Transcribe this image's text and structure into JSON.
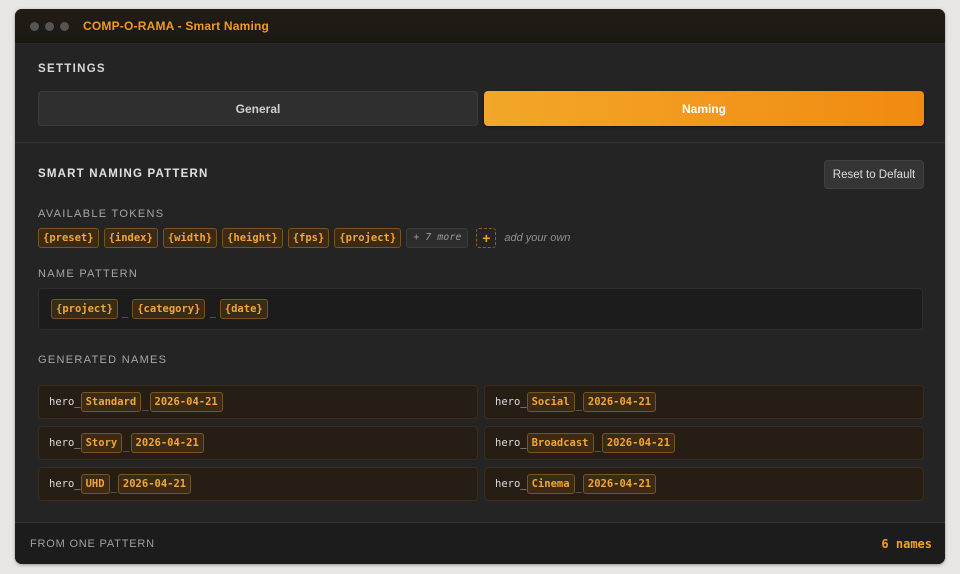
{
  "window": {
    "title": "COMP-O-RAMA - Smart Naming"
  },
  "settings": {
    "label": "SETTINGS",
    "tabs": [
      {
        "label": "General",
        "active": false
      },
      {
        "label": "Naming",
        "active": true
      }
    ]
  },
  "smart_naming": {
    "title": "SMART NAMING PATTERN",
    "reset_label": "Reset to Default",
    "available_tokens_label": "AVAILABLE TOKENS",
    "tokens": [
      "{preset}",
      "{index}",
      "{width}",
      "{height}",
      "{fps}",
      "{project}"
    ],
    "more_label": "+ 7 more",
    "add_symbol": "+",
    "add_label": "add your own",
    "name_pattern_label": "NAME PATTERN",
    "pattern": {
      "tokens": [
        "{project}",
        "{category}",
        "{date}"
      ],
      "separator": "_"
    },
    "generated_label": "GENERATED NAMES",
    "generated": [
      {
        "prefix": "hero_",
        "category": "Standard",
        "sep": "_",
        "date": "2026-04-21"
      },
      {
        "prefix": "hero_",
        "category": "Social",
        "sep": "_",
        "date": "2026-04-21"
      },
      {
        "prefix": "hero_",
        "category": "Story",
        "sep": "_",
        "date": "2026-04-21"
      },
      {
        "prefix": "hero_",
        "category": "Broadcast",
        "sep": "_",
        "date": "2026-04-21"
      },
      {
        "prefix": "hero_",
        "category": "UHD",
        "sep": "_",
        "date": "2026-04-21"
      },
      {
        "prefix": "hero_",
        "category": "Cinema",
        "sep": "_",
        "date": "2026-04-21"
      }
    ]
  },
  "footer": {
    "label": "FROM ONE PATTERN",
    "count": "6 names"
  },
  "colors": {
    "accent": "#f29a1f",
    "window_bg": "#242424",
    "chip_bg": "#3b2a14"
  }
}
